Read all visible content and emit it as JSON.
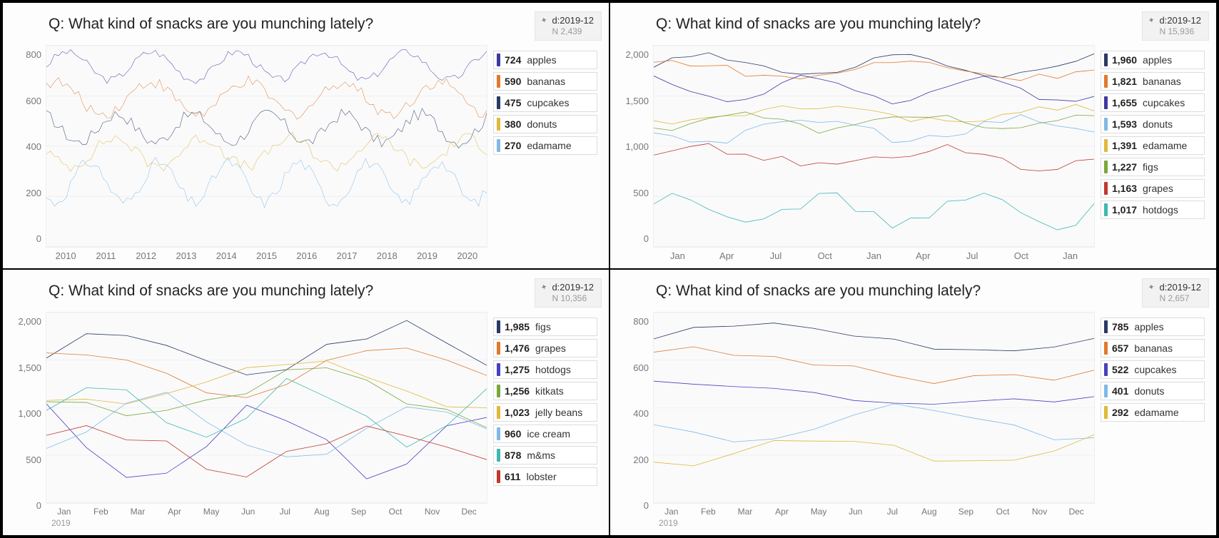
{
  "chart_data": [
    {
      "id": "panel-tl",
      "type": "line",
      "title": "Q: What kind of snacks are you munching lately?",
      "date_label": "d:2019-12",
      "n_label": "N 2,439",
      "xlabel": "",
      "ylabel": "",
      "ylim": [
        0,
        800
      ],
      "yticks": [
        "800",
        "600",
        "400",
        "200",
        "0"
      ],
      "xticks": [
        "2010",
        "2011",
        "2012",
        "2013",
        "2014",
        "2015",
        "2016",
        "2017",
        "2018",
        "2019",
        "2020"
      ],
      "xsub": "",
      "legend": [
        {
          "value": "724",
          "label": "apples",
          "color": "#3f3a9f"
        },
        {
          "value": "590",
          "label": "bananas",
          "color": "#e07a2d"
        },
        {
          "value": "475",
          "label": "cupcakes",
          "color": "#2a3a66"
        },
        {
          "value": "380",
          "label": "donuts",
          "color": "#e0b83a"
        },
        {
          "value": "270",
          "label": "edamame",
          "color": "#7fb9e6"
        }
      ],
      "series": [
        {
          "name": "apples",
          "color": "#3f3a9f",
          "freq": 5.2,
          "amp": 0.07,
          "base": 0.9,
          "noise": 0.02
        },
        {
          "name": "bananas",
          "color": "#e07a2d",
          "freq": 4.6,
          "amp": 0.08,
          "base": 0.74,
          "noise": 0.03
        },
        {
          "name": "cupcakes",
          "color": "#2a3a66",
          "freq": 5.8,
          "amp": 0.07,
          "base": 0.59,
          "noise": 0.03
        },
        {
          "name": "donuts",
          "color": "#e0b83a",
          "freq": 5.0,
          "amp": 0.07,
          "base": 0.47,
          "noise": 0.03
        },
        {
          "name": "edamame",
          "color": "#7fb9e6",
          "freq": 6.3,
          "amp": 0.1,
          "base": 0.32,
          "noise": 0.03
        }
      ],
      "points": 110
    },
    {
      "id": "panel-tr",
      "type": "line",
      "title": "Q: What kind of snacks are you munching lately?",
      "date_label": "d:2019-12",
      "n_label": "N 15,936",
      "ylim": [
        0,
        2000
      ],
      "yticks": [
        "2,000",
        "1,500",
        "1,000",
        "500",
        "0"
      ],
      "xticks": [
        "Jan",
        "Apr",
        "Jul",
        "Oct",
        "Jan",
        "Apr",
        "Jul",
        "Oct",
        "Jan"
      ],
      "xsub": "",
      "legend": [
        {
          "value": "1,960",
          "label": "apples",
          "color": "#2a3a66"
        },
        {
          "value": "1,821",
          "label": "bananas",
          "color": "#e07a2d"
        },
        {
          "value": "1,655",
          "label": "cupcakes",
          "color": "#3f3a9f"
        },
        {
          "value": "1,593",
          "label": "donuts",
          "color": "#7fb9e6"
        },
        {
          "value": "1,391",
          "label": "edamame",
          "color": "#e0b83a"
        },
        {
          "value": "1,227",
          "label": "figs",
          "color": "#7aa83a"
        },
        {
          "value": "1,163",
          "label": "grapes",
          "color": "#c0392b"
        },
        {
          "value": "1,017",
          "label": "hotdogs",
          "color": "#3fb8b0"
        }
      ],
      "series": [
        {
          "name": "apples",
          "color": "#2a3a66",
          "freq": 2.2,
          "amp": 0.05,
          "base": 0.9,
          "noise": 0.02
        },
        {
          "name": "bananas",
          "color": "#e07a2d",
          "freq": 1.9,
          "amp": 0.04,
          "base": 0.88,
          "noise": 0.02
        },
        {
          "name": "cupcakes",
          "color": "#3f3a9f",
          "freq": 2.6,
          "amp": 0.06,
          "base": 0.78,
          "noise": 0.02
        },
        {
          "name": "donuts",
          "color": "#7fb9e6",
          "freq": 2.1,
          "amp": 0.05,
          "base": 0.58,
          "noise": 0.03
        },
        {
          "name": "edamame",
          "color": "#e0b83a",
          "freq": 1.7,
          "amp": 0.04,
          "base": 0.66,
          "noise": 0.02
        },
        {
          "name": "figs",
          "color": "#7aa83a",
          "freq": 2.4,
          "amp": 0.04,
          "base": 0.62,
          "noise": 0.02
        },
        {
          "name": "grapes",
          "color": "#c0392b",
          "freq": 2.0,
          "amp": 0.05,
          "base": 0.44,
          "noise": 0.03
        },
        {
          "name": "hotdogs",
          "color": "#3fb8b0",
          "freq": 2.9,
          "amp": 0.07,
          "base": 0.18,
          "noise": 0.03
        }
      ],
      "points": 25
    },
    {
      "id": "panel-bl",
      "type": "line",
      "title": "Q: What kind of snacks are you munching lately?",
      "date_label": "d:2019-12",
      "n_label": "N 10,356",
      "ylim": [
        0,
        2000
      ],
      "yticks": [
        "2,000",
        "1,500",
        "1,000",
        "500",
        "0"
      ],
      "xticks": [
        "Jan",
        "Feb",
        "Mar",
        "Apr",
        "May",
        "Jun",
        "Jul",
        "Aug",
        "Sep",
        "Oct",
        "Nov",
        "Dec"
      ],
      "xsub": "2019",
      "legend": [
        {
          "value": "1,985",
          "label": "figs",
          "color": "#2a3a66"
        },
        {
          "value": "1,476",
          "label": "grapes",
          "color": "#e07a2d"
        },
        {
          "value": "1,275",
          "label": "hotdogs",
          "color": "#4a3fbf"
        },
        {
          "value": "1,256",
          "label": "kitkats",
          "color": "#7aa83a"
        },
        {
          "value": "1,023",
          "label": "jelly beans",
          "color": "#e0b83a"
        },
        {
          "value": "960",
          "label": "ice cream",
          "color": "#7fb9e6"
        },
        {
          "value": "878",
          "label": "m&ms",
          "color": "#3fb8b0"
        },
        {
          "value": "611",
          "label": "lobster",
          "color": "#c0392b"
        }
      ],
      "series": [
        {
          "name": "figs",
          "color": "#2a3a66",
          "freq": 1.6,
          "amp": 0.15,
          "base": 0.78,
          "noise": 0.05
        },
        {
          "name": "grapes",
          "color": "#e07a2d",
          "freq": 1.4,
          "amp": 0.12,
          "base": 0.68,
          "noise": 0.04
        },
        {
          "name": "hotdogs",
          "color": "#4a3fbf",
          "freq": 1.9,
          "amp": 0.18,
          "base": 0.32,
          "noise": 0.05
        },
        {
          "name": "kitkats",
          "color": "#7aa83a",
          "freq": 1.3,
          "amp": 0.12,
          "base": 0.55,
          "noise": 0.05
        },
        {
          "name": "jelly beans",
          "color": "#e0b83a",
          "freq": 1.1,
          "amp": 0.1,
          "base": 0.62,
          "noise": 0.04
        },
        {
          "name": "ice cream",
          "color": "#7fb9e6",
          "freq": 1.7,
          "amp": 0.14,
          "base": 0.4,
          "noise": 0.05
        },
        {
          "name": "m&ms",
          "color": "#3fb8b0",
          "freq": 2.2,
          "amp": 0.15,
          "base": 0.48,
          "noise": 0.05
        },
        {
          "name": "lobster",
          "color": "#c0392b",
          "freq": 1.5,
          "amp": 0.12,
          "base": 0.3,
          "noise": 0.05
        }
      ],
      "points": 12
    },
    {
      "id": "panel-br",
      "type": "line",
      "title": "Q: What kind of snacks are you munching lately?",
      "date_label": "d:2019-12",
      "n_label": "N 2,657",
      "ylim": [
        0,
        800
      ],
      "yticks": [
        "800",
        "600",
        "400",
        "200",
        "0"
      ],
      "xticks": [
        "Jan",
        "Feb",
        "Mar",
        "Apr",
        "May",
        "Jun",
        "Jul",
        "Aug",
        "Sep",
        "Oct",
        "Nov",
        "Dec"
      ],
      "xsub": "2019",
      "legend": [
        {
          "value": "785",
          "label": "apples",
          "color": "#2a3a66"
        },
        {
          "value": "657",
          "label": "bananas",
          "color": "#e07a2d"
        },
        {
          "value": "522",
          "label": "cupcakes",
          "color": "#4a3fbf"
        },
        {
          "value": "401",
          "label": "donuts",
          "color": "#7fb9e6"
        },
        {
          "value": "292",
          "label": "edamame",
          "color": "#e0b83a"
        }
      ],
      "series": [
        {
          "name": "apples",
          "color": "#2a3a66",
          "freq": 1.0,
          "amp": 0.06,
          "base": 0.87,
          "noise": 0.02
        },
        {
          "name": "bananas",
          "color": "#e07a2d",
          "freq": 0.8,
          "amp": 0.08,
          "base": 0.72,
          "noise": 0.03
        },
        {
          "name": "cupcakes",
          "color": "#4a3fbf",
          "freq": 0.6,
          "amp": 0.05,
          "base": 0.58,
          "noise": 0.02
        },
        {
          "name": "donuts",
          "color": "#7fb9e6",
          "freq": 1.3,
          "amp": 0.09,
          "base": 0.42,
          "noise": 0.03
        },
        {
          "name": "edamame",
          "color": "#e0b83a",
          "freq": 1.5,
          "amp": 0.08,
          "base": 0.28,
          "noise": 0.03
        }
      ],
      "points": 12
    }
  ]
}
